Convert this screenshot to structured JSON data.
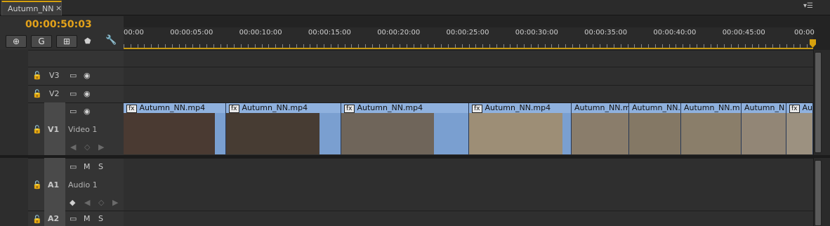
{
  "panel": {
    "tab_label": "Autumn_NN",
    "tab_close": "×",
    "menu_icon": "▾☰"
  },
  "timecode": "00:00:50:03",
  "toolbar": {
    "buttons": [
      {
        "name": "snap-button",
        "icon": "snap-icon",
        "glyph": "⊕"
      },
      {
        "name": "linked-selection-button",
        "icon": "link-icon",
        "glyph": "G"
      },
      {
        "name": "add-marker-button",
        "icon": "marker-icon",
        "glyph": "⊞"
      }
    ],
    "marker_glyph": "⬟",
    "wrench_glyph": "🔧"
  },
  "ruler": {
    "labels": [
      "00:00",
      "00:00:05:00",
      "00:00:10:00",
      "00:00:15:00",
      "00:00:20:00",
      "00:00:25:00",
      "00:00:30:00",
      "00:00:35:00",
      "00:00:40:00",
      "00:00:45:00",
      "00:00"
    ]
  },
  "tracks": {
    "v3": {
      "name": "V3",
      "lock": "🔓",
      "film": "▭",
      "eye": "◉"
    },
    "v2": {
      "name": "V2",
      "lock": "🔓",
      "film": "▭",
      "eye": "◉"
    },
    "v1": {
      "name": "V1",
      "label": "Video 1",
      "lock": "🔓",
      "film": "▭",
      "eye": "◉",
      "kf_prev": "◀",
      "kf_add": "◇",
      "kf_next": "▶"
    },
    "a1": {
      "name": "A1",
      "label": "Audio 1",
      "lock": "🔓",
      "film": "▭",
      "mute": "M",
      "solo": "S",
      "kf_tgl": "◆",
      "kf_prev": "◀",
      "kf_add": "◇",
      "kf_next": "▶"
    },
    "a2": {
      "name": "A2",
      "lock": "🔓",
      "film": "▭",
      "mute": "M",
      "solo": "S"
    }
  },
  "clips": [
    {
      "label": "Autumn_NN.mp4",
      "fx": "fx",
      "thumb": "#4a3a32"
    },
    {
      "label": "Autumn_NN.mp4",
      "fx": "fx",
      "thumb": "#473c33"
    },
    {
      "label": "Autumn_NN.mp4",
      "fx": "fx",
      "thumb": "#6f655a"
    },
    {
      "label": "Autumn_NN.mp4",
      "fx": "fx",
      "thumb": "#9d8e76"
    },
    {
      "label": "Autumn_NN.m",
      "fx": "",
      "thumb": "#8a7d6b"
    },
    {
      "label": "Autumn_NN.",
      "fx": "",
      "thumb": "#847865"
    },
    {
      "label": "Autumn_NN.m",
      "fx": "",
      "thumb": "#8a7e6a"
    },
    {
      "label": "Autumn_N",
      "fx": "",
      "thumb": "#928676"
    },
    {
      "label": "Au",
      "fx": "fx",
      "thumb": "#9c9180"
    }
  ]
}
